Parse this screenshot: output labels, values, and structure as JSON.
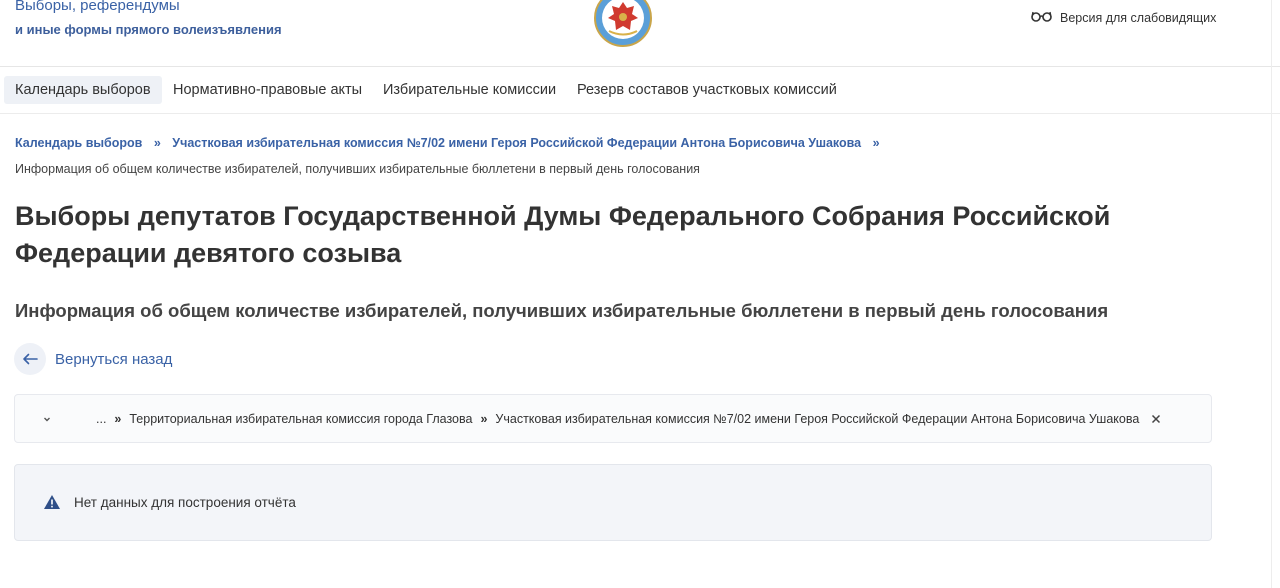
{
  "header": {
    "site_title_line1": "Выборы, референдумы",
    "site_title_line2": "и иные формы прямого волеизъявления",
    "emblem_icon": "cik-emblem-icon",
    "vision_icon": "glasses-icon",
    "vision_label": "Версия для слабовидящих"
  },
  "nav": {
    "items": [
      {
        "label": "Календарь выборов",
        "active": true
      },
      {
        "label": "Нормативно-правовые акты",
        "active": false
      },
      {
        "label": "Избирательные комиссии",
        "active": false
      },
      {
        "label": "Резерв составов участковых комиссий",
        "active": false
      }
    ]
  },
  "breadcrumbs": {
    "items": [
      "Календарь выборов",
      "Участковая избирательная комиссия №7/02 имени Героя Российской Федерации Антона Борисовича Ушакова"
    ],
    "separator": "»",
    "current": "Информация об общем количестве избирателей, получивших избирательные бюллетени в первый день голосования"
  },
  "main": {
    "title": "Выборы депутатов Государственной Думы Федерального Собрания Российской Федерации девятого созыва",
    "subtitle": "Информация об общем количестве избирателей, получивших избирательные бюллетени в первый день голосования",
    "back_label": "Вернуться назад",
    "back_icon": "arrow-left-icon"
  },
  "filter": {
    "expand_icon": "chevron-down-icon",
    "ellipsis": "...",
    "separator": "»",
    "path": [
      "Территориальная избирательная комиссия города Глазова",
      "Участковая избирательная комиссия №7/02 имени Героя Российской Федерации Антона Борисовича Ушакова"
    ],
    "close_icon": "close-icon"
  },
  "notice": {
    "icon": "warning-icon",
    "text": "Нет данных для построения отчёта"
  },
  "colors": {
    "link": "#3a62a6",
    "active_nav_bg": "#eef1f6",
    "notice_bg": "#f3f5f9",
    "warning_icon": "#2f4f88"
  }
}
